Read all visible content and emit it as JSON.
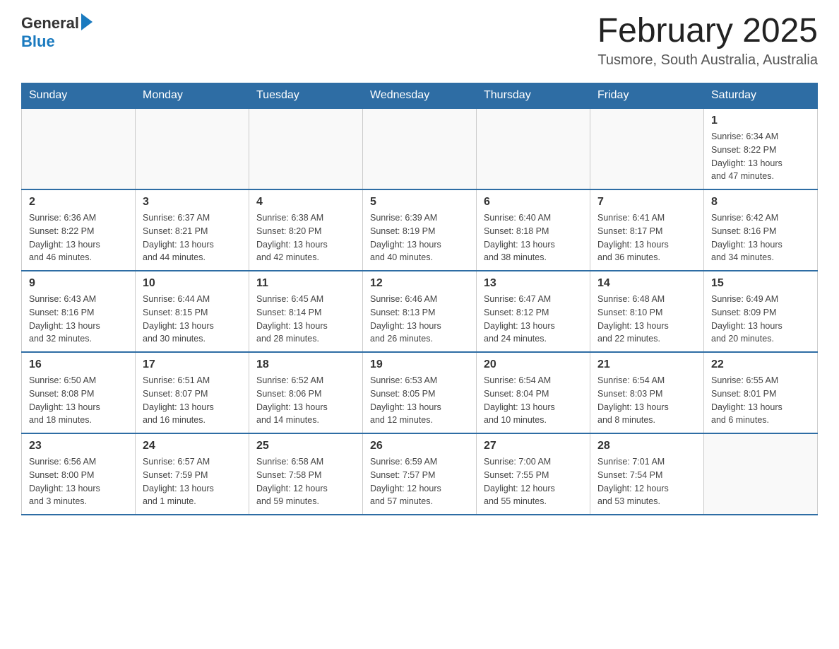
{
  "header": {
    "logo_general": "General",
    "logo_blue": "Blue",
    "month_title": "February 2025",
    "location": "Tusmore, South Australia, Australia"
  },
  "days_of_week": [
    "Sunday",
    "Monday",
    "Tuesday",
    "Wednesday",
    "Thursday",
    "Friday",
    "Saturday"
  ],
  "weeks": [
    [
      {
        "day": "",
        "info": ""
      },
      {
        "day": "",
        "info": ""
      },
      {
        "day": "",
        "info": ""
      },
      {
        "day": "",
        "info": ""
      },
      {
        "day": "",
        "info": ""
      },
      {
        "day": "",
        "info": ""
      },
      {
        "day": "1",
        "info": "Sunrise: 6:34 AM\nSunset: 8:22 PM\nDaylight: 13 hours\nand 47 minutes."
      }
    ],
    [
      {
        "day": "2",
        "info": "Sunrise: 6:36 AM\nSunset: 8:22 PM\nDaylight: 13 hours\nand 46 minutes."
      },
      {
        "day": "3",
        "info": "Sunrise: 6:37 AM\nSunset: 8:21 PM\nDaylight: 13 hours\nand 44 minutes."
      },
      {
        "day": "4",
        "info": "Sunrise: 6:38 AM\nSunset: 8:20 PM\nDaylight: 13 hours\nand 42 minutes."
      },
      {
        "day": "5",
        "info": "Sunrise: 6:39 AM\nSunset: 8:19 PM\nDaylight: 13 hours\nand 40 minutes."
      },
      {
        "day": "6",
        "info": "Sunrise: 6:40 AM\nSunset: 8:18 PM\nDaylight: 13 hours\nand 38 minutes."
      },
      {
        "day": "7",
        "info": "Sunrise: 6:41 AM\nSunset: 8:17 PM\nDaylight: 13 hours\nand 36 minutes."
      },
      {
        "day": "8",
        "info": "Sunrise: 6:42 AM\nSunset: 8:16 PM\nDaylight: 13 hours\nand 34 minutes."
      }
    ],
    [
      {
        "day": "9",
        "info": "Sunrise: 6:43 AM\nSunset: 8:16 PM\nDaylight: 13 hours\nand 32 minutes."
      },
      {
        "day": "10",
        "info": "Sunrise: 6:44 AM\nSunset: 8:15 PM\nDaylight: 13 hours\nand 30 minutes."
      },
      {
        "day": "11",
        "info": "Sunrise: 6:45 AM\nSunset: 8:14 PM\nDaylight: 13 hours\nand 28 minutes."
      },
      {
        "day": "12",
        "info": "Sunrise: 6:46 AM\nSunset: 8:13 PM\nDaylight: 13 hours\nand 26 minutes."
      },
      {
        "day": "13",
        "info": "Sunrise: 6:47 AM\nSunset: 8:12 PM\nDaylight: 13 hours\nand 24 minutes."
      },
      {
        "day": "14",
        "info": "Sunrise: 6:48 AM\nSunset: 8:10 PM\nDaylight: 13 hours\nand 22 minutes."
      },
      {
        "day": "15",
        "info": "Sunrise: 6:49 AM\nSunset: 8:09 PM\nDaylight: 13 hours\nand 20 minutes."
      }
    ],
    [
      {
        "day": "16",
        "info": "Sunrise: 6:50 AM\nSunset: 8:08 PM\nDaylight: 13 hours\nand 18 minutes."
      },
      {
        "day": "17",
        "info": "Sunrise: 6:51 AM\nSunset: 8:07 PM\nDaylight: 13 hours\nand 16 minutes."
      },
      {
        "day": "18",
        "info": "Sunrise: 6:52 AM\nSunset: 8:06 PM\nDaylight: 13 hours\nand 14 minutes."
      },
      {
        "day": "19",
        "info": "Sunrise: 6:53 AM\nSunset: 8:05 PM\nDaylight: 13 hours\nand 12 minutes."
      },
      {
        "day": "20",
        "info": "Sunrise: 6:54 AM\nSunset: 8:04 PM\nDaylight: 13 hours\nand 10 minutes."
      },
      {
        "day": "21",
        "info": "Sunrise: 6:54 AM\nSunset: 8:03 PM\nDaylight: 13 hours\nand 8 minutes."
      },
      {
        "day": "22",
        "info": "Sunrise: 6:55 AM\nSunset: 8:01 PM\nDaylight: 13 hours\nand 6 minutes."
      }
    ],
    [
      {
        "day": "23",
        "info": "Sunrise: 6:56 AM\nSunset: 8:00 PM\nDaylight: 13 hours\nand 3 minutes."
      },
      {
        "day": "24",
        "info": "Sunrise: 6:57 AM\nSunset: 7:59 PM\nDaylight: 13 hours\nand 1 minute."
      },
      {
        "day": "25",
        "info": "Sunrise: 6:58 AM\nSunset: 7:58 PM\nDaylight: 12 hours\nand 59 minutes."
      },
      {
        "day": "26",
        "info": "Sunrise: 6:59 AM\nSunset: 7:57 PM\nDaylight: 12 hours\nand 57 minutes."
      },
      {
        "day": "27",
        "info": "Sunrise: 7:00 AM\nSunset: 7:55 PM\nDaylight: 12 hours\nand 55 minutes."
      },
      {
        "day": "28",
        "info": "Sunrise: 7:01 AM\nSunset: 7:54 PM\nDaylight: 12 hours\nand 53 minutes."
      },
      {
        "day": "",
        "info": ""
      }
    ]
  ]
}
